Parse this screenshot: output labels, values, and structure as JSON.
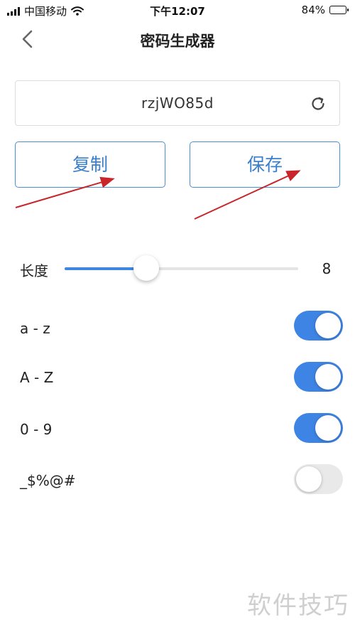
{
  "status_bar": {
    "carrier": "中国移动",
    "time": "下午12:07",
    "battery": "84%",
    "battery_level": 0.84
  },
  "nav": {
    "title": "密码生成器",
    "back_icon": "chevron-left-icon"
  },
  "password": {
    "value": "rzjWO85d",
    "refresh_icon": "refresh-icon"
  },
  "actions": {
    "copy_label": "复制",
    "save_label": "保存"
  },
  "length": {
    "label": "长度",
    "value": "8",
    "slider_fraction": 0.35
  },
  "options": [
    {
      "label": "a - z",
      "enabled": true
    },
    {
      "label": "A - Z",
      "enabled": true
    },
    {
      "label": "0 - 9",
      "enabled": true
    },
    {
      "label": "_$%@#",
      "enabled": false
    }
  ],
  "watermark": "软件技巧",
  "colors": {
    "accent": "#3e84e4",
    "button_text": "#3a7fcb",
    "annotation_arrow": "#c8262a",
    "toggle_off": "#e9e9e9"
  }
}
